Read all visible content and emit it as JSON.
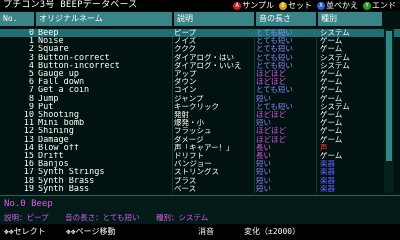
{
  "title": "プチコン3号 BEEPデータベース",
  "hints": [
    {
      "key": "A",
      "label": "サンプル",
      "color": "#d02020"
    },
    {
      "key": "B",
      "label": "セット",
      "color": "#d0a000"
    },
    {
      "key": "X",
      "label": "並べかえ",
      "color": "#2060d0"
    },
    {
      "key": "Y",
      "label": "エンド",
      "color": "#20a020"
    }
  ],
  "columns": {
    "no": "No.",
    "name": "オリジナルネーム",
    "desc": "説明",
    "length": "音の長さ",
    "category": "種別"
  },
  "rows": [
    {
      "no": "0",
      "name": "Beep",
      "desc": "ピープ",
      "length": "とても短い",
      "category": "システム",
      "lenColor": "#8a8aff"
    },
    {
      "no": "1",
      "name": "Noise",
      "desc": "ノイズ",
      "length": "とても短い",
      "category": "ゲーム",
      "lenColor": "#8a8aff"
    },
    {
      "no": "2",
      "name": "Square",
      "desc": "ククク",
      "length": "とても短い",
      "category": "ゲーム",
      "lenColor": "#8a8aff"
    },
    {
      "no": "3",
      "name": "Button-correct",
      "desc": "ダイアログ・はい",
      "length": "とても短い",
      "category": "システム",
      "lenColor": "#8a8aff"
    },
    {
      "no": "4",
      "name": "Button-incorrect",
      "desc": "ダイアログ・いいえ",
      "length": "とても短い",
      "category": "システム",
      "lenColor": "#8a8aff"
    },
    {
      "no": "5",
      "name": "Gauge up",
      "desc": "アップ",
      "length": "ほどほど",
      "category": "ゲーム",
      "lenColor": "#d85cf0"
    },
    {
      "no": "6",
      "name": "Fall down",
      "desc": "ダウン",
      "length": "ほどほど",
      "category": "ゲーム",
      "lenColor": "#d85cf0"
    },
    {
      "no": "7",
      "name": "Get a coin",
      "desc": "コイン",
      "length": "とても短い",
      "category": "ゲーム",
      "lenColor": "#8a8aff"
    },
    {
      "no": "8",
      "name": "Jump",
      "desc": "ジャンプ",
      "length": "短い",
      "category": "ゲーム",
      "lenColor": "#8a8aff"
    },
    {
      "no": "9",
      "name": "Put",
      "desc": "キークリック",
      "length": "とても短い",
      "category": "システム",
      "lenColor": "#8a8aff"
    },
    {
      "no": "10",
      "name": "Shooting",
      "desc": "発射",
      "length": "ほどほど",
      "category": "ゲーム",
      "lenColor": "#d85cf0"
    },
    {
      "no": "11",
      "name": "Mini bomb",
      "desc": "爆発・小",
      "length": "短い",
      "category": "ゲーム",
      "lenColor": "#8a8aff"
    },
    {
      "no": "12",
      "name": "Shining",
      "desc": "フラッシュ",
      "length": "ほどほど",
      "category": "ゲーム",
      "lenColor": "#d85cf0"
    },
    {
      "no": "13",
      "name": "Damage",
      "desc": "ダメージ",
      "length": "ほどほど",
      "category": "ゲーム",
      "lenColor": "#d85cf0"
    },
    {
      "no": "14",
      "name": "Blow off",
      "desc": "声「キャアー！」",
      "length": "長い",
      "category": "声",
      "lenColor": "#d85cf0",
      "catColor": "#ff3030"
    },
    {
      "no": "15",
      "name": "Drift",
      "desc": "ドリフト",
      "length": "長い",
      "category": "ゲーム",
      "lenColor": "#d85cf0"
    },
    {
      "no": "16",
      "name": "Banjos",
      "desc": "バンジョー",
      "length": "短い",
      "category": "楽器",
      "lenColor": "#8a8aff",
      "catColor": "#6060ff"
    },
    {
      "no": "17",
      "name": "Synth Strings",
      "desc": "ストリングス",
      "length": "短い",
      "category": "楽器",
      "lenColor": "#8a8aff",
      "catColor": "#6060ff"
    },
    {
      "no": "18",
      "name": "Synth Brass",
      "desc": "ブラス",
      "length": "短い",
      "category": "楽器",
      "lenColor": "#8a8aff",
      "catColor": "#6060ff"
    },
    {
      "no": "19",
      "name": "Synth Bass",
      "desc": "ベース",
      "length": "短い",
      "category": "楽器",
      "lenColor": "#8a8aff",
      "catColor": "#6060ff"
    }
  ],
  "selectedIndex": 0,
  "detail": {
    "headline": "No.0 Beep",
    "desc_label": "説明：ピープ",
    "length_label": "音の長さ：とても短い",
    "category_label": "種別：システム"
  },
  "footer": {
    "select": "✥✥セレクト",
    "page": "✥✥ページ移動",
    "mute": "消音",
    "pitch": "変化（±2000）"
  }
}
